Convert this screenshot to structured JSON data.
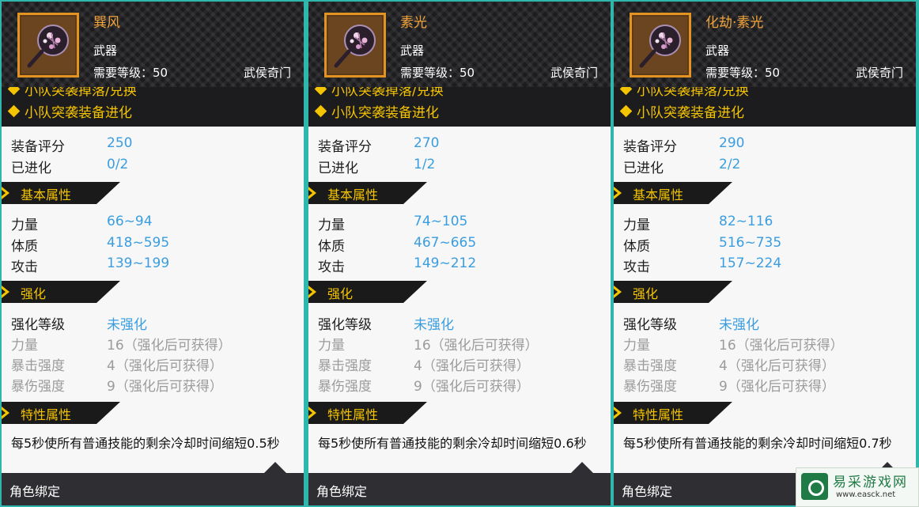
{
  "cards": [
    {
      "name": "巽风",
      "type": "武器",
      "req_level": "需要等级：50",
      "class": "武侯奇门",
      "tag1": "小队突袭掉落/兑换",
      "tag2": "小队突袭装备进化",
      "score_label": "装备评分",
      "score": "250",
      "evo_label": "已进化",
      "evo": "0/2",
      "sec_basic": "基本属性",
      "str_label": "力量",
      "str": "66~94",
      "con_label": "体质",
      "con": "418~595",
      "atk_label": "攻击",
      "atk": "139~199",
      "sec_enh": "强化",
      "enh_level_label": "强化等级",
      "enh_level": "未强化",
      "enh_str_label": "力量",
      "enh_str": "16（强化后可获得）",
      "enh_crit_label": "暴击强度",
      "enh_crit": "4（强化后可获得）",
      "enh_critdmg_label": "暴伤强度",
      "enh_critdmg": "9（强化后可获得）",
      "sec_trait": "特性属性",
      "trait": "每5秒使所有普通技能的剩余冷却时间缩短0.5秒",
      "footer": "角色绑定"
    },
    {
      "name": "素光",
      "type": "武器",
      "req_level": "需要等级：50",
      "class": "武侯奇门",
      "tag1": "小队突袭掉落/兑换",
      "tag2": "小队突袭装备进化",
      "score_label": "装备评分",
      "score": "270",
      "evo_label": "已进化",
      "evo": "1/2",
      "sec_basic": "基本属性",
      "str_label": "力量",
      "str": "74~105",
      "con_label": "体质",
      "con": "467~665",
      "atk_label": "攻击",
      "atk": "149~212",
      "sec_enh": "强化",
      "enh_level_label": "强化等级",
      "enh_level": "未强化",
      "enh_str_label": "力量",
      "enh_str": "16（强化后可获得）",
      "enh_crit_label": "暴击强度",
      "enh_crit": "4（强化后可获得）",
      "enh_critdmg_label": "暴伤强度",
      "enh_critdmg": "9（强化后可获得）",
      "sec_trait": "特性属性",
      "trait": "每5秒使所有普通技能的剩余冷却时间缩短0.6秒",
      "footer": "角色绑定"
    },
    {
      "name": "化劫·素光",
      "type": "武器",
      "req_level": "需要等级：50",
      "class": "武侯奇门",
      "tag1": "小队突袭掉落/兑换",
      "tag2": "小队突袭装备进化",
      "score_label": "装备评分",
      "score": "290",
      "evo_label": "已进化",
      "evo": "2/2",
      "sec_basic": "基本属性",
      "str_label": "力量",
      "str": "82~116",
      "con_label": "体质",
      "con": "516~735",
      "atk_label": "攻击",
      "atk": "157~224",
      "sec_enh": "强化",
      "enh_level_label": "强化等级",
      "enh_level": "未强化",
      "enh_str_label": "力量",
      "enh_str": "16（强化后可获得）",
      "enh_crit_label": "暴击强度",
      "enh_crit": "4（强化后可获得）",
      "enh_critdmg_label": "暴伤强度",
      "enh_critdmg": "9（强化后可获得）",
      "sec_trait": "特性属性",
      "trait": "每5秒使所有普通技能的剩余冷却时间缩短0.7秒",
      "footer": "角色绑定"
    }
  ],
  "watermark": {
    "text": "易采游戏网",
    "url": "www.easck.net",
    "icon": "easck-logo-icon"
  },
  "colors": {
    "accent": "#f5c400",
    "name": "#f2a43a",
    "value": "#3a9de0",
    "header": "#1c1c1f",
    "border": "#2fb7ad"
  }
}
